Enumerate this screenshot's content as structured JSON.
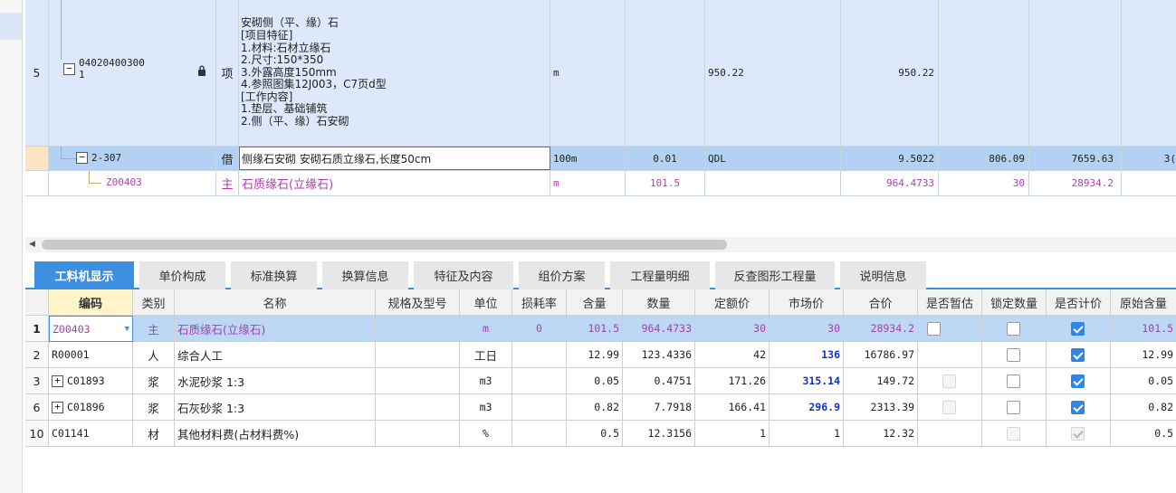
{
  "upper": {
    "row5": {
      "index": "5",
      "code_line1": "04020400300",
      "code_line2": "1",
      "type": "项",
      "description": "安砌侧（平、缘）石\n[项目特征]\n1.材料:石材立缘石\n2.尺寸:150*350\n3.外露高度150mm\n4.参照图集12J003，C7页d型\n[工作内容]\n1.垫层、基础铺筑\n2.侧（平、缘）石安砌",
      "unit": "m",
      "quantity": "950.22",
      "total": "950.22"
    },
    "sub_row": {
      "code": "2-307",
      "type": "借",
      "description": "侧缘石安砌 安砌石质立缘石,长度50cm",
      "unit": "100m",
      "coef": "0.01",
      "qty_expr": "QDL",
      "quantity": "9.5022",
      "unit_price": "806.09",
      "total": "7659.63",
      "cut": "3("
    },
    "mat_row": {
      "code": "Z00403",
      "type": "主",
      "description": "石质缘石(立缘石)",
      "unit": "m",
      "coef": "101.5",
      "quantity": "964.4733",
      "unit_price": "30",
      "total": "28934.2"
    }
  },
  "tabs": [
    "工料机显示",
    "单价构成",
    "标准换算",
    "换算信息",
    "特征及内容",
    "组价方案",
    "工程量明细",
    "反查图形工程量",
    "说明信息"
  ],
  "lower": {
    "headers": [
      "编码",
      "类别",
      "名称",
      "规格及型号",
      "单位",
      "损耗率",
      "含量",
      "数量",
      "定额价",
      "市场价",
      "合价",
      "是否暂估",
      "锁定数量",
      "是否计价",
      "原始含量"
    ],
    "rows": [
      {
        "rn": "1",
        "code": "Z00403",
        "cat": "主",
        "name": "石质缘石(立缘石)",
        "spec": "",
        "unit": "m",
        "loss": "0",
        "content": "101.5",
        "qty": "964.4733",
        "base": "30",
        "market": "30",
        "total": "28934.2",
        "orig": "101.5"
      },
      {
        "rn": "2",
        "code": "R00001",
        "cat": "人",
        "name": "综合人工",
        "spec": "",
        "unit": "工日",
        "loss": "",
        "content": "12.99",
        "qty": "123.4336",
        "base": "42",
        "market": "136",
        "total": "16786.97",
        "orig": "12.99"
      },
      {
        "rn": "3",
        "code": "C01893",
        "cat": "浆",
        "name": "水泥砂浆 1:3",
        "spec": "",
        "unit": "m3",
        "loss": "",
        "content": "0.05",
        "qty": "0.4751",
        "base": "171.26",
        "market": "315.14",
        "total": "149.72",
        "orig": "0.05"
      },
      {
        "rn": "6",
        "code": "C01896",
        "cat": "浆",
        "name": "石灰砂浆 1:3",
        "spec": "",
        "unit": "m3",
        "loss": "",
        "content": "0.82",
        "qty": "7.7918",
        "base": "166.41",
        "market": "296.9",
        "total": "2313.39",
        "orig": "0.82"
      },
      {
        "rn": "10",
        "code": "C01141",
        "cat": "材",
        "name": "其他材料费(占材料费%)",
        "spec": "",
        "unit": "%",
        "loss": "",
        "content": "0.5",
        "qty": "12.3156",
        "base": "1",
        "market": "1",
        "total": "12.32",
        "orig": "0.5"
      }
    ],
    "expand_symbol": "+",
    "collapse_symbol": "−"
  },
  "icons": {
    "lock": "lock-icon",
    "dropdown": "dropdown-arrow-icon"
  },
  "colors": {
    "accent": "#3d8fe0",
    "purple_text": "#b03fb3",
    "market_blue": "#1530c4"
  }
}
